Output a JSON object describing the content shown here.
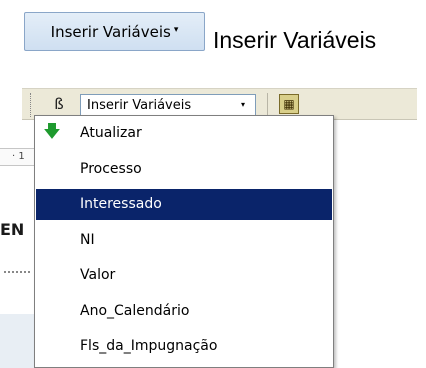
{
  "top_button": {
    "label": "Inserir Variáveis",
    "arrow": "▾"
  },
  "caption": "Inserir Variáveis",
  "toolbar": {
    "left_icon": "script-icon",
    "left_icon_glyph": "ß",
    "combo_label": "Inserir Variáveis",
    "combo_arrow": "▾",
    "right_icon": "grid-icon",
    "right_icon_glyph": "▦"
  },
  "document": {
    "ruler_text": "· 1",
    "visible_word": "EN"
  },
  "menu": {
    "items": [
      {
        "label": "Atualizar",
        "icon": "down-arrow-icon",
        "glyph": "🡇",
        "selected": false
      },
      {
        "label": "Processo",
        "selected": false
      },
      {
        "label": "Interessado",
        "selected": true
      },
      {
        "label": "NI",
        "selected": false
      },
      {
        "label": "Valor",
        "selected": false
      },
      {
        "label": "Ano_Calendário",
        "selected": false
      },
      {
        "label": "Fls_da_Impugnação",
        "selected": false
      }
    ]
  },
  "colors": {
    "selection": "#0a246a",
    "toolbar_bg": "#ece9d8",
    "refresh_arrow": "#1e9a2e"
  }
}
